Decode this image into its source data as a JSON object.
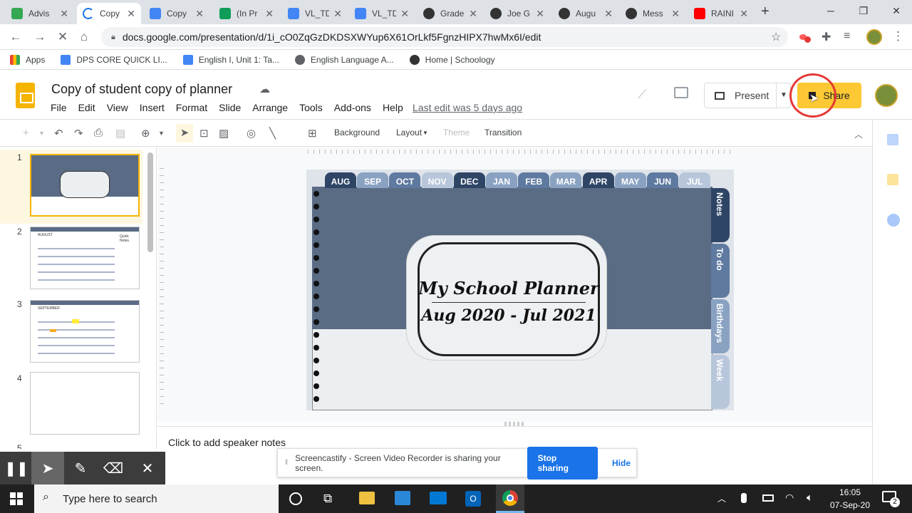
{
  "browser": {
    "tabs": [
      {
        "title": "Advis",
        "color": "#34a853"
      },
      {
        "title": "Copy",
        "color": "#1a73e8"
      },
      {
        "title": "Copy",
        "color": "#4285f4"
      },
      {
        "title": "(In Pr",
        "color": "#0f9d58"
      },
      {
        "title": "VL_TD",
        "color": "#4285f4"
      },
      {
        "title": "VL_TD",
        "color": "#4285f4"
      },
      {
        "title": "Grade",
        "color": "#333333"
      },
      {
        "title": "Joe G",
        "color": "#333333"
      },
      {
        "title": "Augu",
        "color": "#333333"
      },
      {
        "title": "Mess",
        "color": "#333333"
      },
      {
        "title": "RAINI",
        "color": "#ff0000"
      }
    ],
    "new_tab": "+",
    "url": "docs.google.com/presentation/d/1i_cO0ZqGzDKDSXWYup6X61OrLkf5FgnzHIPX7hwMx6I/edit",
    "bookmarks": [
      "Apps",
      "DPS CORE QUICK LI...",
      "English I, Unit 1: Ta...",
      "English Language A...",
      "Home | Schoology"
    ]
  },
  "slides": {
    "doc_title": "Copy of student copy of planner",
    "menus": [
      "File",
      "Edit",
      "View",
      "Insert",
      "Format",
      "Slide",
      "Arrange",
      "Tools",
      "Add-ons",
      "Help"
    ],
    "last_edit": "Last edit was 5 days ago",
    "present_label": "Present",
    "share_label": "Share",
    "toolbar": {
      "background": "Background",
      "layout": "Layout",
      "theme": "Theme",
      "transition": "Transition"
    },
    "slide_numbers": [
      "1",
      "2",
      "3",
      "4",
      "5"
    ],
    "thumb2_label": "AUGUST",
    "thumb2_notes": "Quick Notes",
    "thumb3_label": "SEPTEMBER",
    "notes_placeholder": "Click to add speaker notes"
  },
  "slide": {
    "months": [
      "AUG",
      "SEP",
      "OCT",
      "NOV",
      "DEC",
      "JAN",
      "FEB",
      "MAR",
      "APR",
      "MAY",
      "JUN",
      "JUL"
    ],
    "title": "My School Planner",
    "subtitle": "Aug 2020 - Jul 2021",
    "side_tabs": [
      "Notes",
      "To do",
      "Birthdays",
      "Week"
    ]
  },
  "screencastify": {
    "message": "Screencastify - Screen Video Recorder is sharing your screen.",
    "stop": "Stop sharing",
    "hide": "Hide"
  },
  "taskbar": {
    "search_placeholder": "Type here to search",
    "time": "16:05",
    "date": "07-Sep-20",
    "notifications": "2"
  }
}
